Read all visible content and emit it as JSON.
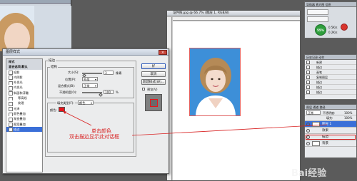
{
  "left_window": {
    "title": ""
  },
  "document": {
    "title": "证件照.jpg @ 66.7% (图层 1, RGB/8)",
    "ruler_top_numbers": [
      "0",
      "2",
      "4",
      "6",
      "8"
    ]
  },
  "top_right_panel": {
    "tabs": [
      "导航器",
      "直方图",
      "信息"
    ],
    "badge_text": "55%",
    "line1": "0.5K/s",
    "line2": "0.2K/s"
  },
  "history_panel": {
    "tabs": [
      "历史记录",
      "动作"
    ],
    "rows": [
      "新建",
      "描边",
      "画笔",
      "复制图层",
      "描边",
      "描边",
      "描边"
    ]
  },
  "layers_panel": {
    "tabs": [
      "图层",
      "通道",
      "路径"
    ],
    "blend_mode": "正常",
    "opacity_label": "不透明度:",
    "opacity_value": "100%",
    "fill_label": "填充:",
    "fill_value": "100%",
    "layers": [
      {
        "name": "图层 1",
        "selected": true
      },
      {
        "name": "效果",
        "selected": false
      },
      {
        "name": "描边",
        "selected": false
      },
      {
        "name": "背景",
        "selected": false
      }
    ]
  },
  "dialog": {
    "title": "图层样式",
    "close_symbol": "×",
    "styles": [
      {
        "label": "样式",
        "type": "header"
      },
      {
        "label": "混合选项:默认",
        "type": "header"
      },
      {
        "label": "投影",
        "type": "check"
      },
      {
        "label": "内阴影",
        "type": "check"
      },
      {
        "label": "外发光",
        "type": "check"
      },
      {
        "label": "内发光",
        "type": "check"
      },
      {
        "label": "斜面和浮雕",
        "type": "check"
      },
      {
        "label": "等高线",
        "type": "check"
      },
      {
        "label": "纹理",
        "type": "check"
      },
      {
        "label": "光泽",
        "type": "check"
      },
      {
        "label": "颜色叠加",
        "type": "check"
      },
      {
        "label": "渐变叠加",
        "type": "check"
      },
      {
        "label": "图案叠加",
        "type": "check"
      },
      {
        "label": "描边",
        "type": "selected"
      }
    ],
    "group_title": "描边",
    "structure_title": "结构",
    "size_label": "大小(S):",
    "size_value": "3",
    "size_unit": "像素",
    "position_label": "位置(P):",
    "position_value": "外部",
    "blend_label": "混合模式(B):",
    "blend_value": "正常",
    "opacity_label": "不透明度(O):",
    "opacity_value": "100",
    "opacity_unit": "%",
    "fill_type_label": "填充类型(F):",
    "fill_type_value": "颜色",
    "color_label": "颜色:",
    "color_hex": "#e8141b",
    "buttons": {
      "ok": "好",
      "cancel": "取消",
      "new_style": "新建样式(W)...",
      "preview": "预览(V)"
    }
  },
  "annotations": {
    "click_color": "单击颜色",
    "double_click": "双击描边显示此对话框",
    "color": "#d81f1f"
  },
  "watermark": "Bai经验"
}
